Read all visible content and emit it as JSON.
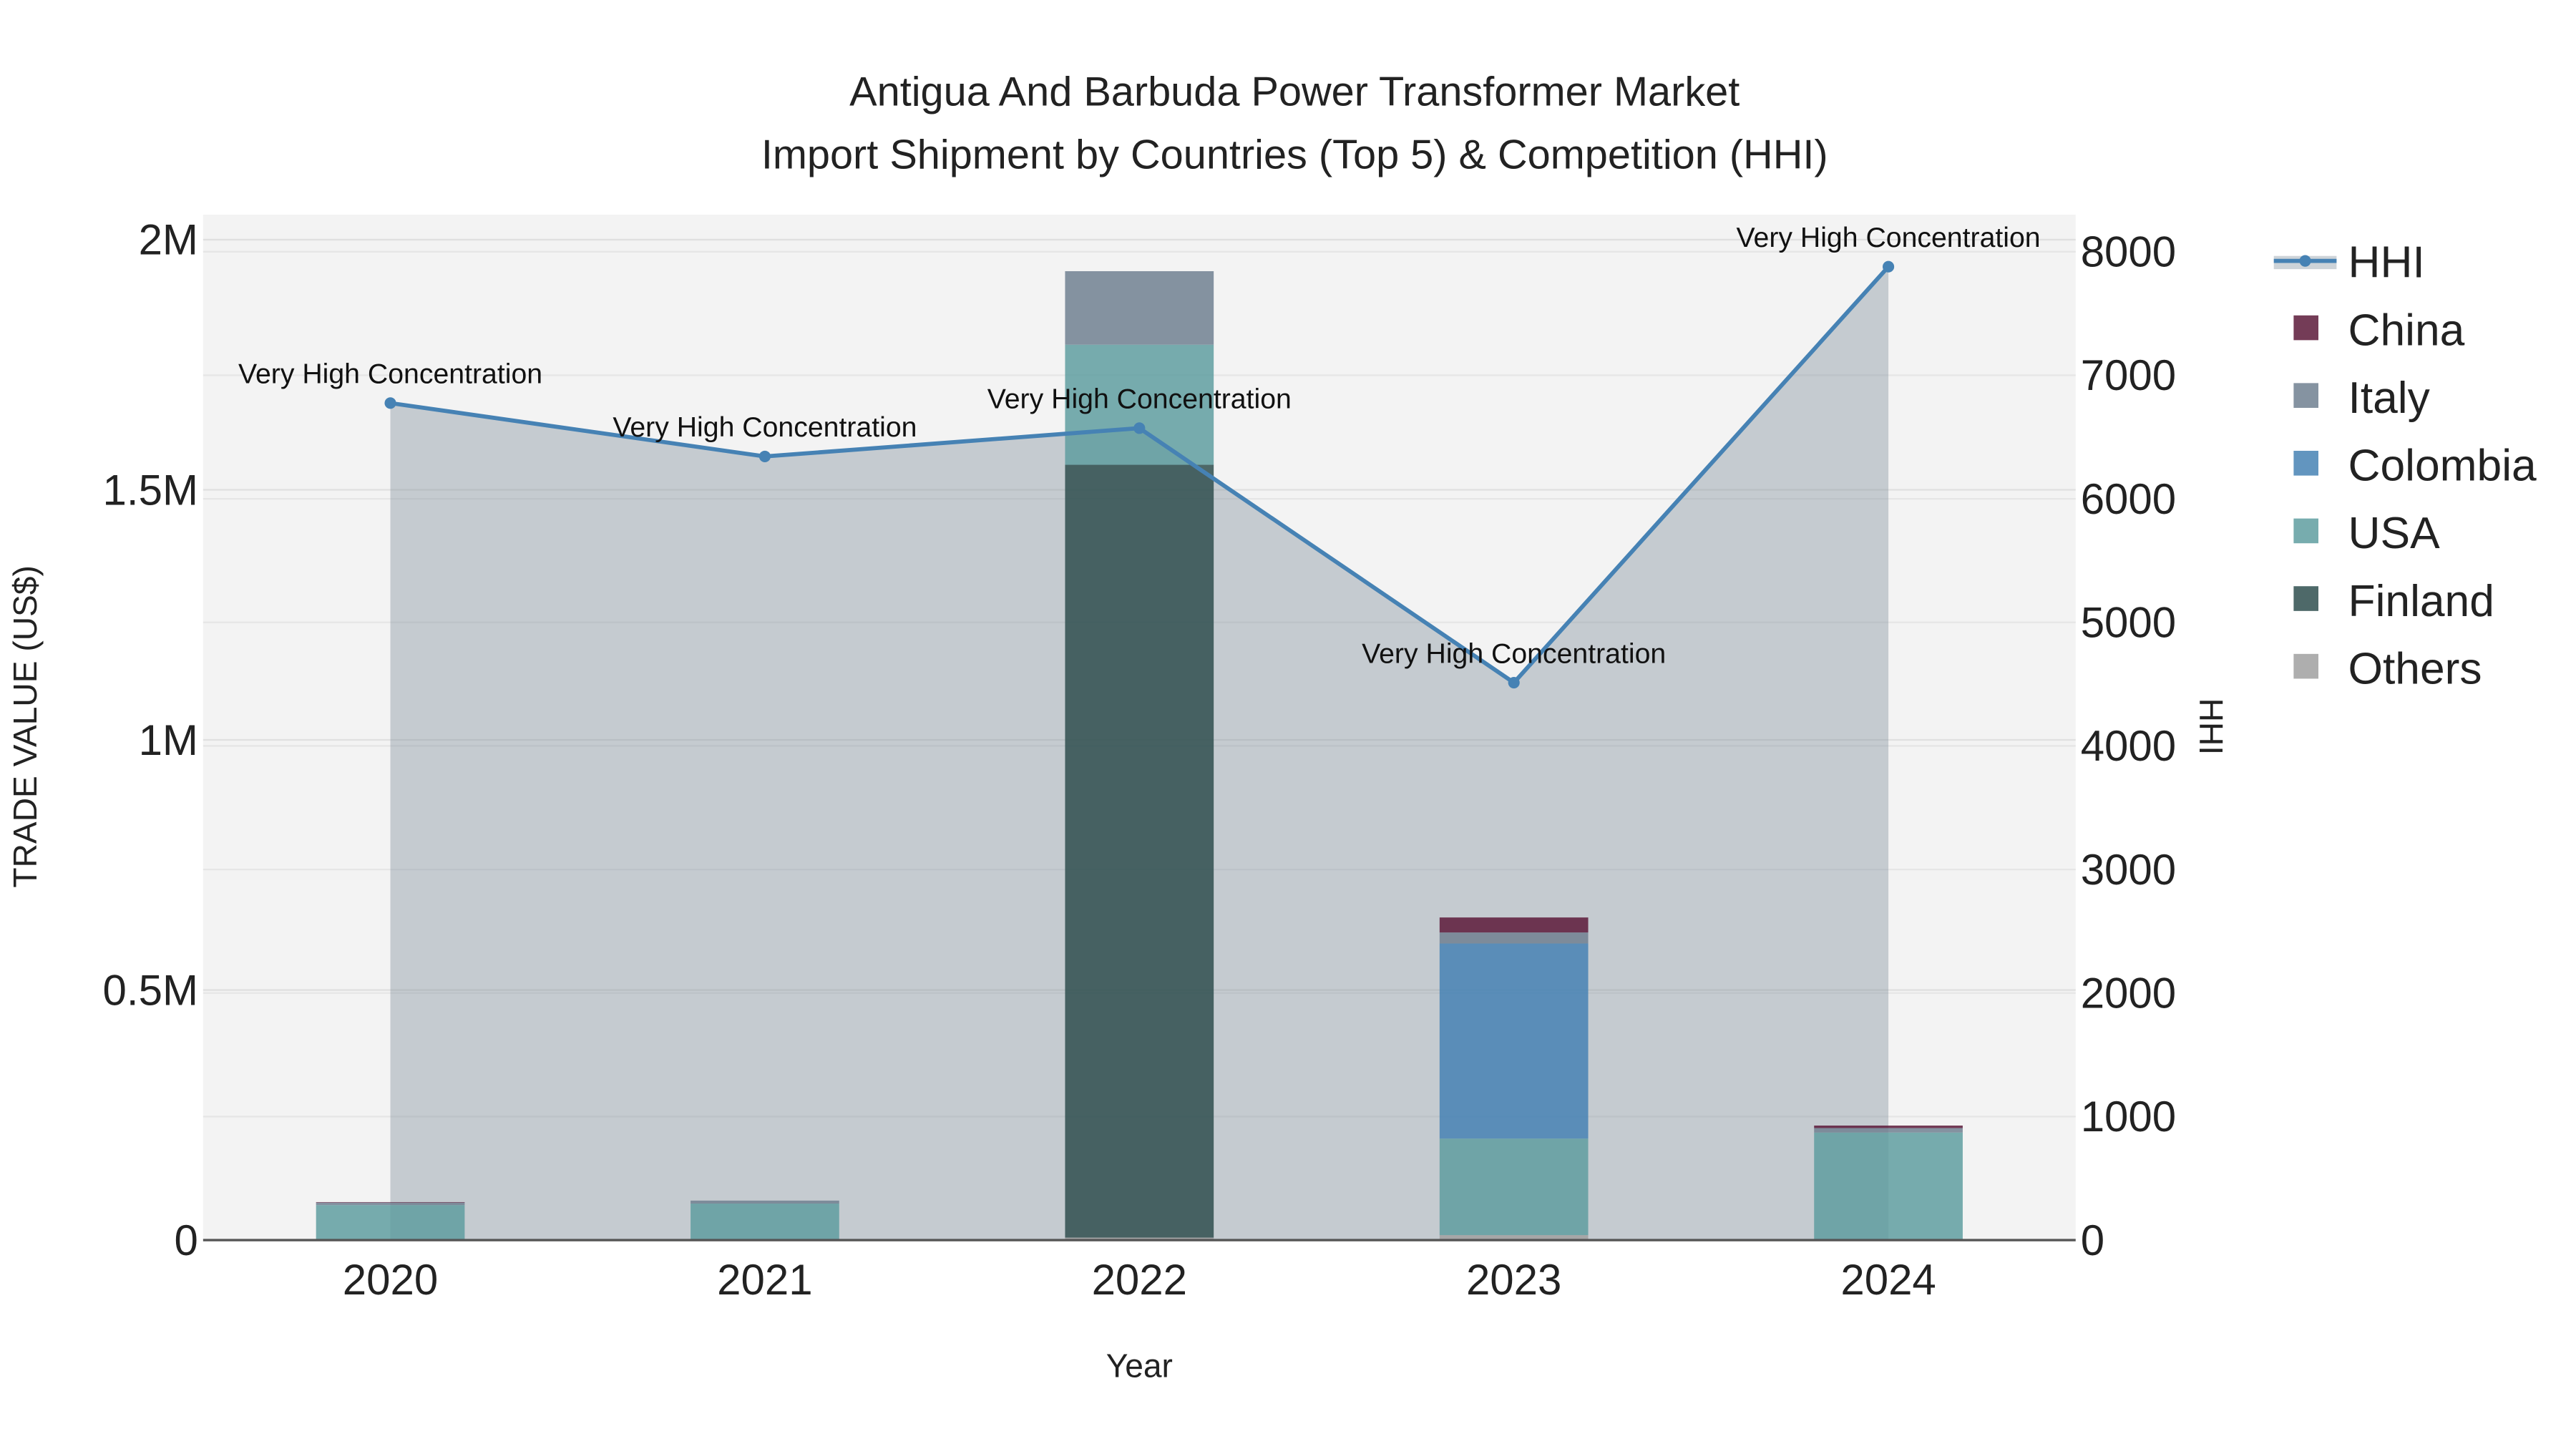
{
  "chart_data": {
    "type": "bar",
    "title": "Antigua And Barbuda Power Transformer Market",
    "subtitle": "Import Shipment by Countries (Top 5) & Competition (HHI)",
    "xlabel": "Year",
    "ylabel": "TRADE VALUE (US$)",
    "y2label": "HHI",
    "categories": [
      "2020",
      "2021",
      "2022",
      "2023",
      "2024"
    ],
    "ylim": [
      0,
      2050000
    ],
    "y2lim": [
      0,
      8300
    ],
    "yticks": [
      {
        "v": 0,
        "label": "0"
      },
      {
        "v": 500000,
        "label": "0.5M"
      },
      {
        "v": 1000000,
        "label": "1M"
      },
      {
        "v": 1500000,
        "label": "1.5M"
      },
      {
        "v": 2000000,
        "label": "2M"
      }
    ],
    "y2ticks": [
      0,
      1000,
      2000,
      3000,
      4000,
      5000,
      6000,
      7000,
      8000
    ],
    "series": [
      {
        "name": "Others",
        "color": "#a0a0a0",
        "values": [
          0,
          1000,
          5000,
          10000,
          0
        ]
      },
      {
        "name": "Finland",
        "color": "#2f4f4f",
        "values": [
          0,
          0,
          1545000,
          0,
          0
        ]
      },
      {
        "name": "USA",
        "color": "#5f9ea0",
        "values": [
          70000,
          72000,
          240000,
          193000,
          215000
        ]
      },
      {
        "name": "Colombia",
        "color": "#4682b4",
        "values": [
          0,
          0,
          0,
          390000,
          0
        ]
      },
      {
        "name": "Italy",
        "color": "#708090",
        "values": [
          5000,
          6000,
          147000,
          22000,
          9000
        ]
      },
      {
        "name": "China",
        "color": "#5c1a3a",
        "values": [
          1000,
          0,
          0,
          30000,
          5000
        ]
      }
    ],
    "hhi": {
      "name": "HHI",
      "color": "#4682b4",
      "values": [
        6775,
        6343,
        6572,
        4512,
        7879
      ],
      "labels": [
        "Very High Concentration",
        "Very High Concentration",
        "Very High Concentration",
        "Very High Concentration",
        "Very High Concentration"
      ]
    },
    "legend": {
      "placement": "right",
      "items": [
        "HHI",
        "China",
        "Italy",
        "Colombia",
        "USA",
        "Finland",
        "Others"
      ]
    }
  }
}
